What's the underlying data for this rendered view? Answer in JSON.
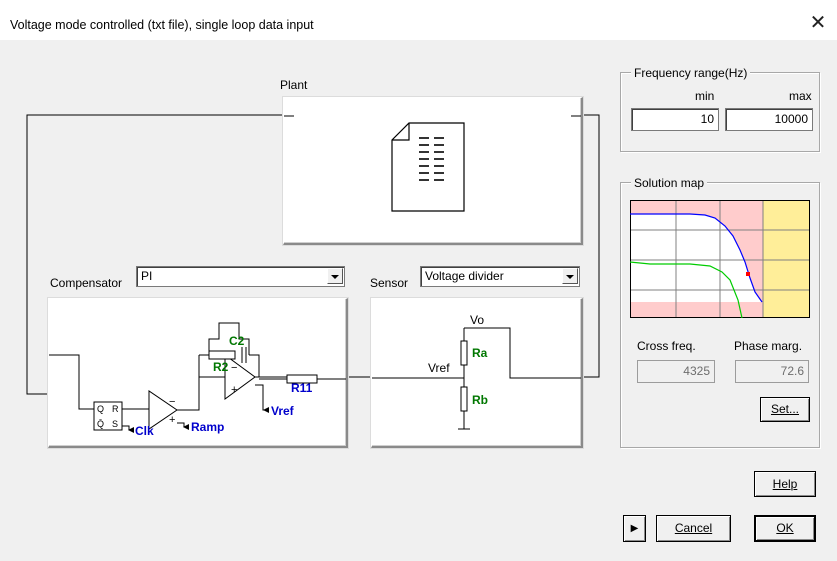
{
  "window": {
    "title": "Voltage mode controlled (txt file), single loop data input",
    "close_glyph": "✕"
  },
  "plant": {
    "label": "Plant"
  },
  "compensator": {
    "label": "Compensator",
    "selected": "PI",
    "schematic": {
      "c2": "C2",
      "r2": "R2",
      "r11": "R11",
      "vref": "Vref",
      "ramp": "Ramp",
      "clk": "Clk",
      "q": "Q",
      "qbar": "Q̄",
      "r": "R",
      "s": "S"
    }
  },
  "sensor": {
    "label": "Sensor",
    "selected": "Voltage divider",
    "schematic": {
      "vo": "Vo",
      "vref": "Vref",
      "ra": "Ra",
      "rb": "Rb"
    }
  },
  "frequency": {
    "title": "Frequency range(Hz)",
    "min_label": "min",
    "max_label": "max",
    "min": "10",
    "max": "10000"
  },
  "solution": {
    "title": "Solution map",
    "cross_label": "Cross freq.",
    "cross_value": "4325",
    "phase_label": "Phase marg.",
    "phase_value": "72.6",
    "set_button": "Set..."
  },
  "buttons": {
    "help": "Help",
    "cancel": "Cancel",
    "ok": "OK",
    "play_glyph": "▶"
  },
  "colors": {
    "schematic_blue": "#0000cc",
    "schematic_green": "#007700",
    "map_pink": "#ffcccc",
    "map_yellow": "#ffee99",
    "curve_blue": "#0000ff",
    "curve_green": "#00cc00",
    "marker_red": "#ff0000"
  }
}
